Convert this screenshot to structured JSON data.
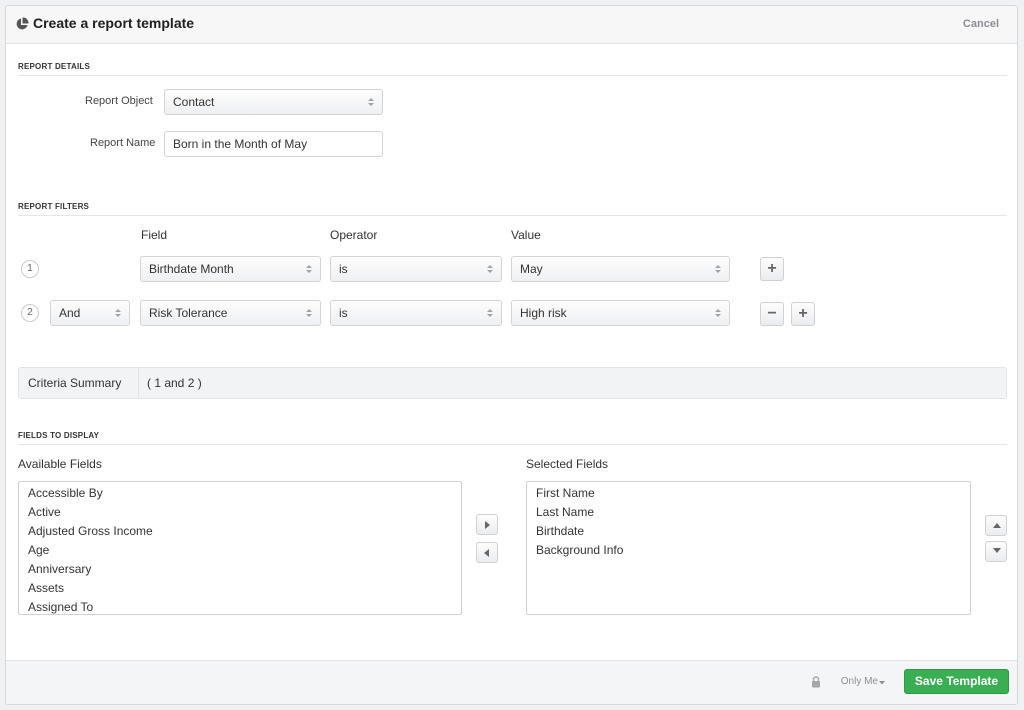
{
  "header": {
    "title": "Create a report template",
    "cancel_label": "Cancel"
  },
  "report_details": {
    "section_title": "REPORT DETAILS",
    "object_label": "Report Object",
    "object_value": "Contact",
    "name_label": "Report Name",
    "name_value": "Born in the Month of May"
  },
  "report_filters": {
    "section_title": "REPORT FILTERS",
    "col_field": "Field",
    "col_operator": "Operator",
    "col_value": "Value",
    "rows": [
      {
        "num": "1",
        "field": "Birthdate Month",
        "operator": "is",
        "value": "May"
      },
      {
        "num": "2",
        "conjunction": "And",
        "field": "Risk Tolerance",
        "operator": "is",
        "value": "High risk"
      }
    ],
    "add_symbol": "+",
    "remove_symbol": "−"
  },
  "criteria": {
    "label": "Criteria Summary",
    "value": "( 1 and 2 )"
  },
  "fields_to_display": {
    "section_title": "FIELDS TO DISPLAY",
    "available_label": "Available Fields",
    "selected_label": "Selected Fields",
    "available": [
      "Accessible By",
      "Active",
      "Adjusted Gross Income",
      "Age",
      "Anniversary",
      "Assets",
      "Assigned To"
    ],
    "selected": [
      "First Name",
      "Last Name",
      "Birthdate",
      "Background Info"
    ]
  },
  "footer": {
    "visibility": "Only Me",
    "save_label": "Save Template"
  },
  "colors": {
    "accent_green": "#3aae52",
    "muted_text": "#8b8f95"
  },
  "icons": {
    "header": "pie-chart-icon",
    "lock": "lock-icon",
    "move_right": "chevron-right-icon",
    "move_left": "chevron-left-icon",
    "move_up": "caret-up-icon",
    "move_down": "caret-down-icon"
  }
}
